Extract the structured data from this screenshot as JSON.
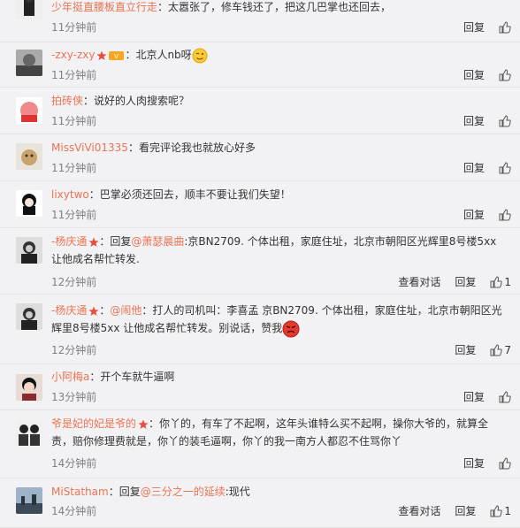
{
  "comments": [
    {
      "user": "少年挺直腰板直立行走",
      "text": "：太嚣张了，修车钱还了，把这几巴掌也还回去，",
      "time": "11分钟前",
      "reply": "回复"
    },
    {
      "user": "-zxy-zxy",
      "text": "：北京人nb呀",
      "time": "11分钟前",
      "reply": "回复"
    },
    {
      "user": "拍砖侠",
      "text": "：说好的人肉搜索呢？",
      "time": "11分钟前",
      "reply": "回复"
    },
    {
      "user": "MissViVi01335",
      "text": "：看完评论我也就放心好多",
      "time": "11分钟前",
      "reply": "回复"
    },
    {
      "user": "lixytwo",
      "text": "：巴掌必须还回去，顺丰不要让我们失望！",
      "time": "11分钟前",
      "reply": "回复"
    },
    {
      "user": "-杨庆通",
      "pre": "：回复",
      "mention": "@萧瑟晨曲",
      "text": ":京BN2709. 个体出租，家庭住址，北京市朝阳区光辉里8号楼5xx 让他成名帮忙转发.",
      "time": "12分钟前",
      "view": "查看对话",
      "reply": "回复",
      "likes": "1"
    },
    {
      "user": "-杨庆通",
      "pre": "：",
      "mention": "@闹他",
      "text": "：打人的司机叫：李喜孟 京BN2709. 个体出租，家庭住址，北京市朝阳区光辉里8号楼5xx 让他成名帮忙转发。别说话，赞我",
      "time": "12分钟前",
      "reply": "回复",
      "likes": "7"
    },
    {
      "user": "小阿梅a",
      "text": "：开个车就牛逼啊",
      "time": "13分钟前",
      "reply": "回复"
    },
    {
      "user": "爷是妃的妃是爷的",
      "text": "：你丫的，有车了不起啊，这年头谁特么买不起啊，操你大爷的，就算全责，赔你修理费就是，你丫的装毛逼啊，你丫的我一南方人都忍不住骂你丫",
      "time": "14分钟前",
      "reply": "回复"
    },
    {
      "user": "MiStatham",
      "pre": "：回复",
      "mention": "@三分之一的延续",
      "text": ":现代",
      "time": "14分钟前",
      "view": "查看对话",
      "reply": "回复",
      "likes": "1"
    }
  ],
  "colors": {
    "link": "#eb7350",
    "text": "#333333",
    "time": "#808080",
    "bg": "#f2f2f5"
  },
  "icons": {
    "like": "thumb-up-icon",
    "badge": "star-badge-icon"
  }
}
